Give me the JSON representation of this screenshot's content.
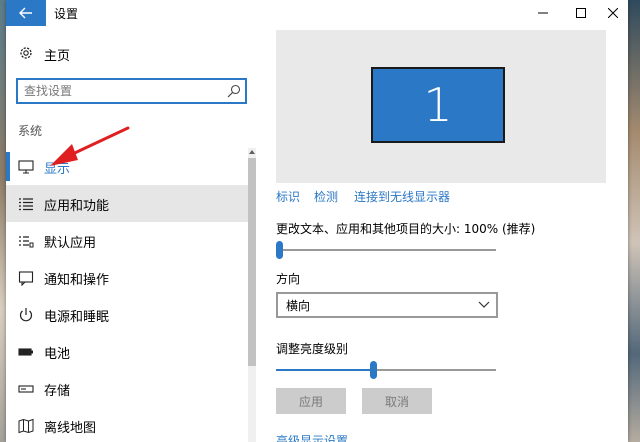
{
  "window": {
    "title": "设置"
  },
  "sidebar": {
    "home_label": "主页",
    "search": {
      "placeholder": "查找设置",
      "value": ""
    },
    "section_label": "系统",
    "items": [
      {
        "label": "显示",
        "icon": "monitor-icon",
        "active": true
      },
      {
        "label": "应用和功能",
        "icon": "apps-list-icon"
      },
      {
        "label": "默认应用",
        "icon": "default-apps-icon"
      },
      {
        "label": "通知和操作",
        "icon": "notification-icon"
      },
      {
        "label": "电源和睡眠",
        "icon": "power-icon"
      },
      {
        "label": "电池",
        "icon": "battery-icon"
      },
      {
        "label": "存储",
        "icon": "storage-icon"
      },
      {
        "label": "离线地图",
        "icon": "offline-map-icon"
      }
    ]
  },
  "display": {
    "monitor_number": "1",
    "links": {
      "identify": "标识",
      "detect": "检测",
      "wireless": "连接到无线显示器"
    },
    "scale_label": "更改文本、应用和其他项目的大小: 100% (推荐)",
    "scale_level": 0.0,
    "orientation_label": "方向",
    "orientation_value": "横向",
    "brightness_label": "调整亮度级别",
    "brightness_level": 0.44,
    "apply_button": "应用",
    "cancel_button": "取消",
    "advanced_link": "高级显示设置"
  },
  "colors": {
    "accent": "#2b78c6",
    "annotation_arrow": "#e02020"
  }
}
